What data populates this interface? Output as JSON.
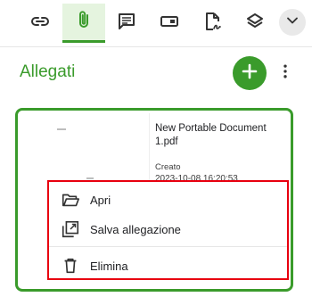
{
  "toolbar": {
    "tools": [
      {
        "name": "link-icon",
        "active": false
      },
      {
        "name": "paperclip-icon",
        "active": true
      },
      {
        "name": "comment-icon",
        "active": false
      },
      {
        "name": "form-field-icon",
        "active": false
      },
      {
        "name": "signature-document-icon",
        "active": false
      },
      {
        "name": "layers-icon",
        "active": false
      }
    ],
    "expand_icon": "chevron-down-icon"
  },
  "panel": {
    "title": "Allegati",
    "add_icon": "plus-icon",
    "more_icon": "more-vertical-icon"
  },
  "attachment": {
    "filename": "New Portable Document 1.pdf",
    "created_label": "Creato",
    "created_date": "2023-10-08 16:20:53"
  },
  "context_menu": {
    "items": [
      {
        "label": "Apri",
        "icon": "folder-open-icon"
      },
      {
        "label": "Salva allegazione",
        "icon": "save-copy-icon"
      },
      {
        "label": "Elimina",
        "icon": "trash-icon"
      }
    ]
  },
  "colors": {
    "accent": "#3a9b2b",
    "accent_light": "#e5f4df",
    "highlight": "#e8000f"
  }
}
